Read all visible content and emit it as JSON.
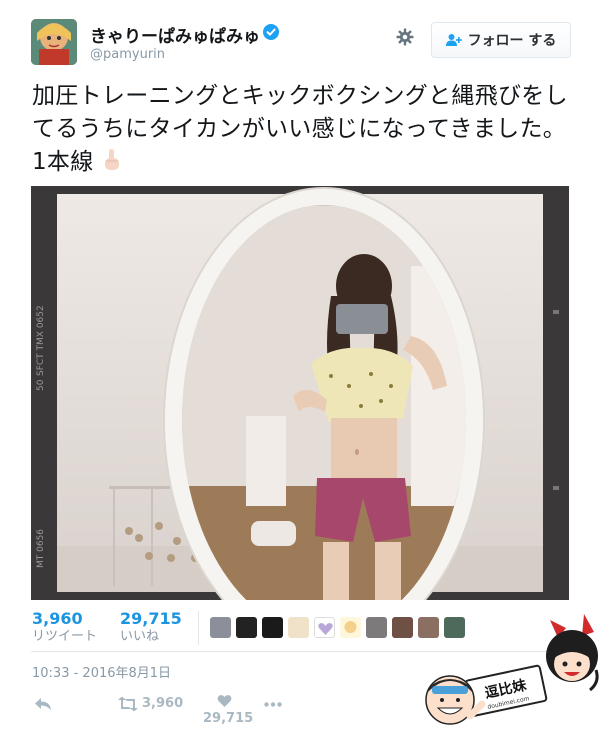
{
  "user": {
    "display_name": "きゃりーぱみゅぱみゅ",
    "handle": "@pamyurin",
    "verified": true
  },
  "header": {
    "follow_label": "フォロー する",
    "icons": [
      "gear-icon",
      "follow-person-icon",
      "verified-badge-icon"
    ]
  },
  "tweet": {
    "text": "加圧トレーニングとキックボクシングと縄飛びをしてるうちにタイカンがいい感じになってきました。1本線",
    "emoji": "pointing-up-hand"
  },
  "photo": {
    "film_edge_texts": [
      "SFCT TMX 0652",
      "50",
      "MT 0656"
    ]
  },
  "stats": {
    "retweets": "3,960",
    "retweets_label": "リツイート",
    "likes": "29,715",
    "likes_label": "いいね",
    "liker_count": 10
  },
  "timestamp": "10:33 - 2016年8月1日",
  "actions": {
    "retweet_count": "3,960",
    "like_count": "29,715",
    "icons": [
      "reply-icon",
      "retweet-icon",
      "like-icon",
      "more-icon"
    ]
  },
  "watermark": {
    "title": "逗比妹",
    "url": "doubimei.com"
  },
  "colors": {
    "link_blue": "#1b95e0",
    "muted": "#8899a6",
    "verified_blue": "#1da1f2"
  }
}
